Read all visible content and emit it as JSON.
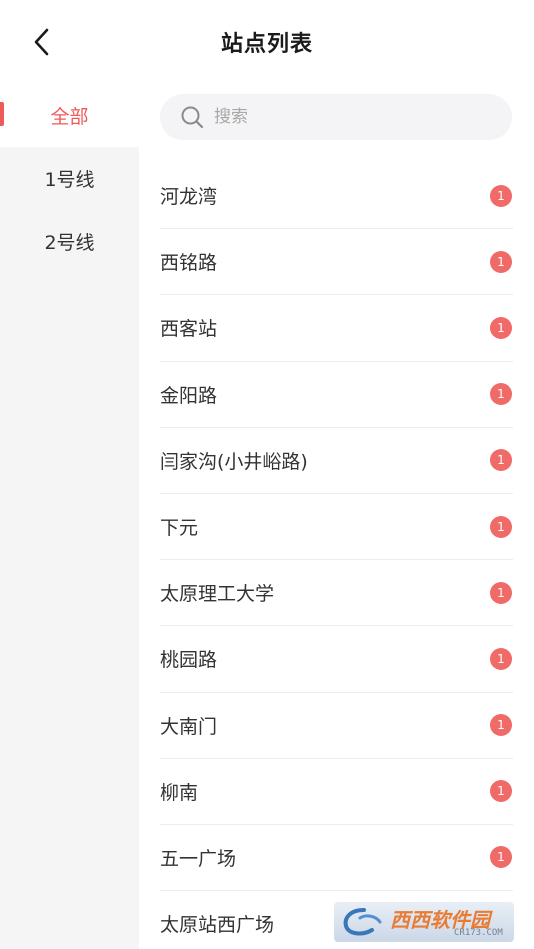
{
  "header": {
    "title": "站点列表",
    "back_icon": "chevron-left-icon"
  },
  "sidebar": {
    "items": [
      {
        "label": "全部",
        "active": true
      },
      {
        "label": "1号线",
        "active": false
      },
      {
        "label": "2号线",
        "active": false
      }
    ]
  },
  "search": {
    "placeholder": "搜索",
    "value": "",
    "icon": "search-icon"
  },
  "stations": [
    {
      "name": "河龙湾",
      "badge": "1"
    },
    {
      "name": "西铭路",
      "badge": "1"
    },
    {
      "name": "西客站",
      "badge": "1"
    },
    {
      "name": "金阳路",
      "badge": "1"
    },
    {
      "name": "闫家沟(小井峪路)",
      "badge": "1"
    },
    {
      "name": "下元",
      "badge": "1"
    },
    {
      "name": "太原理工大学",
      "badge": "1"
    },
    {
      "name": "桃园路",
      "badge": "1"
    },
    {
      "name": "大南门",
      "badge": "1"
    },
    {
      "name": "柳南",
      "badge": "1"
    },
    {
      "name": "五一广场",
      "badge": "1"
    },
    {
      "name": "太原站西广场",
      "badge": ""
    }
  ],
  "watermark": {
    "text": "西西软件园",
    "sub": "CR173.COM"
  },
  "colors": {
    "accent": "#ee5a58",
    "badge": "#f06a68",
    "sidebar_bg": "#f5f5f5",
    "search_bg": "#f4f4f6"
  }
}
